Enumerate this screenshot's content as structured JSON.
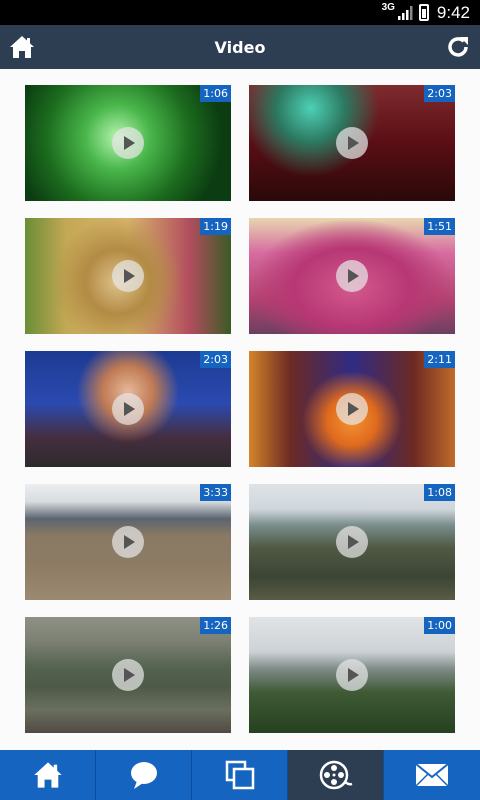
{
  "status_bar": {
    "network": "3G",
    "time": "9:42"
  },
  "header": {
    "title": "Video",
    "home_icon": "home-icon",
    "refresh_icon": "refresh-icon"
  },
  "videos": [
    {
      "duration": "1:06"
    },
    {
      "duration": "2:03"
    },
    {
      "duration": "1:19"
    },
    {
      "duration": "1:51"
    },
    {
      "duration": "2:03"
    },
    {
      "duration": "2:11"
    },
    {
      "duration": "3:33"
    },
    {
      "duration": "1:08"
    },
    {
      "duration": "1:26"
    },
    {
      "duration": "1:00"
    }
  ],
  "tab_bar": {
    "tabs": [
      {
        "icon": "home-icon"
      },
      {
        "icon": "chat-bubble-icon"
      },
      {
        "icon": "gallery-icon"
      },
      {
        "icon": "film-reel-icon",
        "active": true
      },
      {
        "icon": "mail-icon"
      }
    ]
  },
  "colors": {
    "header_bg": "#2d3e52",
    "tab_bar_bg": "#1565c0",
    "duration_badge": "#1565c0",
    "active_tab_bg": "#2d3e52"
  }
}
